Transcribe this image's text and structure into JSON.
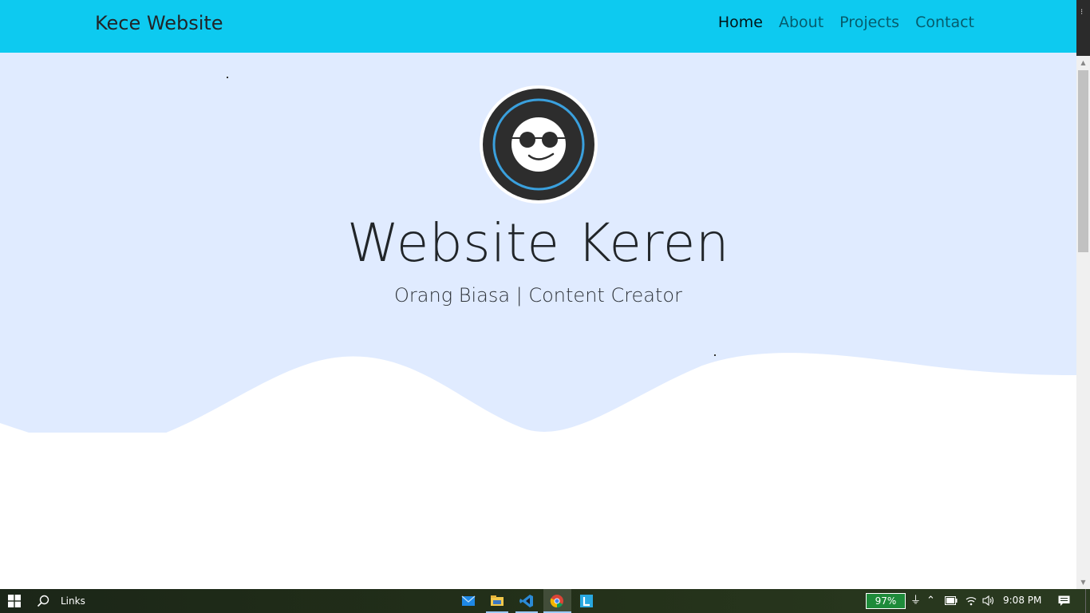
{
  "navbar": {
    "brand": "Kece Website",
    "links": [
      {
        "label": "Home",
        "active": true
      },
      {
        "label": "About",
        "active": false
      },
      {
        "label": "Projects",
        "active": false
      },
      {
        "label": "Contact",
        "active": false
      }
    ]
  },
  "hero": {
    "title": "Website Keren",
    "subtitle": "Orang Biasa | Content Creator",
    "avatar_icon": "sunglasses-smiley-icon"
  },
  "taskbar": {
    "search_label": "Links",
    "apps": [
      "mail-icon",
      "file-explorer-icon",
      "vscode-icon",
      "chrome-icon",
      "l-app-icon"
    ],
    "battery_percent": "97%",
    "time": "9:08 PM"
  },
  "colors": {
    "navbar_bg": "#0dcaf0",
    "hero_bg": "#e0ebff",
    "battery_green": "#1e8b3a"
  }
}
